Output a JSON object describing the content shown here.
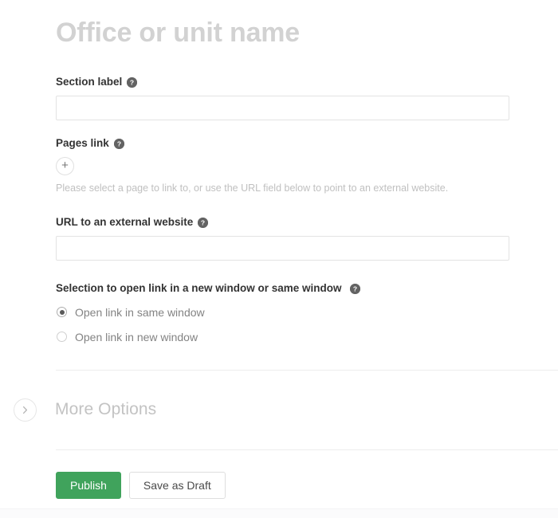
{
  "page": {
    "title": "Office or unit name"
  },
  "fields": {
    "section_label": {
      "label": "Section label",
      "help_icon": "help-circle-icon",
      "value": "",
      "placeholder": ""
    },
    "pages_link": {
      "label": "Pages link",
      "help_icon": "help-circle-icon",
      "add_icon": "plus-icon",
      "helper_text": "Please select a page to link to, or use the URL field below to point to an external website."
    },
    "external_url": {
      "label": "URL to an external website",
      "help_icon": "help-circle-icon",
      "value": "",
      "placeholder": ""
    },
    "window_selection": {
      "label": "Selection to open link in a new window or same window",
      "help_icon": "help-circle-icon",
      "options": [
        {
          "label": "Open link in same window",
          "checked": true
        },
        {
          "label": "Open link in new window",
          "checked": false
        }
      ]
    }
  },
  "more_options": {
    "label": "More Options",
    "toggle_icon": "chevron-right-icon",
    "expanded": false
  },
  "footer": {
    "publish_label": "Publish",
    "save_draft_label": "Save as Draft"
  },
  "colors": {
    "publish_green": "#40a35c",
    "title_gray": "#d2d2d2",
    "label_dark": "#333333",
    "helper_gray": "#c0c0c0",
    "border_gray": "#e3e3e3"
  }
}
